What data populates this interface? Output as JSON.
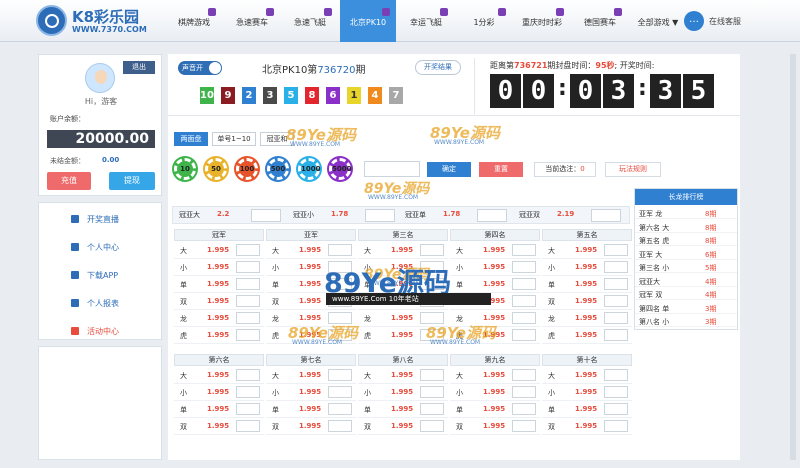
{
  "header": {
    "logo_text": "K8彩乐园",
    "logo_url": "WWW.7370.COM",
    "nav": [
      "棋牌游戏",
      "急速赛车",
      "急速飞艇",
      "北京PK10",
      "幸运飞艇",
      "1分彩",
      "重庆时时彩",
      "德国赛车",
      "全部游戏 ▼"
    ],
    "active_nav_index": 3,
    "service_label": "在线客服"
  },
  "sidebar": {
    "logout": "退出",
    "greeting": "Hi，游客",
    "balance_label": "账户余额：",
    "balance": "20000.00",
    "unpaid_label": "未结金额：",
    "unpaid_value": "0.00",
    "recharge": "充值",
    "withdraw": "提现",
    "menu": [
      {
        "label": "开奖直播",
        "icon": "monitor-icon"
      },
      {
        "label": "个人中心",
        "icon": "user-icon"
      },
      {
        "label": "下载APP",
        "icon": "phone-icon"
      },
      {
        "label": "个人报表",
        "icon": "report-icon"
      },
      {
        "label": "活动中心",
        "icon": "gift-icon"
      }
    ]
  },
  "draw": {
    "sound_label": "声音开",
    "title_prefix": "北京PK10第",
    "period": "736720",
    "title_suffix": "期",
    "result_button": "开奖结果",
    "balls": [
      {
        "num": "10",
        "color": "#3fb44a"
      },
      {
        "num": "9",
        "color": "#8b1c22"
      },
      {
        "num": "2",
        "color": "#2f80d1"
      },
      {
        "num": "3",
        "color": "#4a4a4a"
      },
      {
        "num": "5",
        "color": "#2ab0e8"
      },
      {
        "num": "8",
        "color": "#e3262e"
      },
      {
        "num": "6",
        "color": "#8b2fc9"
      },
      {
        "num": "1",
        "color": "#e8d52a"
      },
      {
        "num": "4",
        "color": "#f08a1e"
      },
      {
        "num": "7",
        "color": "#a8a8a8"
      }
    ],
    "countdown_prefix": "距离第",
    "countdown_period": "736721",
    "countdown_mid": "期封盘时间：",
    "countdown_seconds": "95秒",
    "countdown_suffix": "; 开奖时间:",
    "countdown_digits": [
      "0",
      "0",
      "0",
      "3",
      "3",
      "5"
    ]
  },
  "betting": {
    "tabs": [
      "两面盘",
      "单号1~10",
      "冠亚和"
    ],
    "chips": [
      {
        "value": "10",
        "color": "#3fb44a"
      },
      {
        "value": "50",
        "color": "#e8b32a"
      },
      {
        "value": "100",
        "color": "#e8542a"
      },
      {
        "value": "500",
        "color": "#2f80d1"
      },
      {
        "value": "1000",
        "color": "#2ab0e8"
      },
      {
        "value": "5000",
        "color": "#8b2fc9"
      }
    ],
    "confirm": "确定",
    "reset": "重置",
    "selected_label": "当前选注：",
    "selected_count": "0",
    "rules": "玩法规则",
    "top_row": [
      {
        "label": "冠亚大",
        "odds": "2.2"
      },
      {
        "label": "冠亚小",
        "odds": "1.78"
      },
      {
        "label": "冠亚单",
        "odds": "1.78"
      },
      {
        "label": "冠亚双",
        "odds": "2.19"
      }
    ],
    "blocks_row1": [
      "冠军",
      "亚军",
      "第三名",
      "第四名",
      "第五名"
    ],
    "blocks_row2": [
      "第六名",
      "第七名",
      "第八名",
      "第九名",
      "第十名"
    ],
    "rows_full": [
      "大",
      "小",
      "单",
      "双",
      "龙",
      "虎"
    ],
    "rows_short": [
      "大",
      "小",
      "单",
      "双"
    ],
    "odds": "1.995"
  },
  "dragon": {
    "title": "长龙排行榜",
    "rows": [
      {
        "name": "亚军 龙",
        "count": "8期"
      },
      {
        "name": "第六名 大",
        "count": "8期"
      },
      {
        "name": "第五名 虎",
        "count": "8期"
      },
      {
        "name": "亚军 大",
        "count": "6期"
      },
      {
        "name": "第三名 小",
        "count": "5期"
      },
      {
        "name": "冠亚大",
        "count": "4期"
      },
      {
        "name": "冠军 双",
        "count": "4期"
      },
      {
        "name": "第四名 单",
        "count": "3期"
      },
      {
        "name": "第八名 小",
        "count": "3期"
      }
    ]
  },
  "watermarks": {
    "small_text": "89Ye源码",
    "small_url": "WWW.89YE.COM",
    "big_text": "89Ye源码",
    "big_sub": "www.89YE.Com    10年老站"
  }
}
